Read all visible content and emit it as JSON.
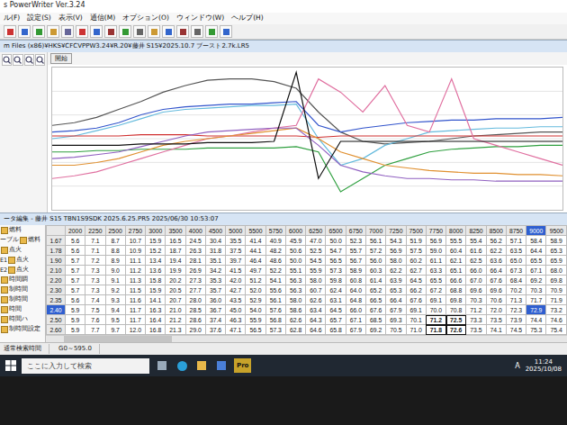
{
  "window": {
    "title": "s PowerWriter Ver.3.24"
  },
  "menu": [
    "ル(F)",
    "設定(S)",
    "表示(V)",
    "通信(M)",
    "オプション(O)",
    "ウィンドウ(W)",
    "ヘルプ(H)"
  ],
  "chart_window": {
    "title": "m Files (x86)¥HKS¥CFCVPPW3.24¥R.20¥藤井 S15¥2025.10.7 ブースト2.7k.LR5",
    "start_button": "開始",
    "series": [
      {
        "color": "#555555",
        "values": [
          60,
          62,
          66,
          72,
          78,
          85,
          90,
          94,
          95,
          95,
          93,
          88,
          70,
          55,
          48,
          46,
          47,
          48,
          50,
          52,
          53,
          54,
          55,
          55
        ]
      },
      {
        "color": "#3355cc",
        "values": [
          55,
          56,
          58,
          62,
          68,
          72,
          74,
          75,
          76,
          76,
          77,
          78,
          60,
          55,
          58,
          60,
          62,
          63,
          64,
          64,
          65,
          65,
          65,
          66
        ]
      },
      {
        "color": "#66bbdd",
        "values": [
          50,
          52,
          56,
          60,
          65,
          70,
          72,
          73,
          74,
          75,
          75,
          76,
          50,
          30,
          35,
          45,
          50,
          55,
          56,
          57,
          58,
          58,
          59,
          59
        ]
      },
      {
        "color": "#d03030",
        "values": [
          52,
          52,
          52,
          52,
          53,
          53,
          53,
          52,
          52,
          52,
          52,
          52,
          51,
          52,
          52,
          52,
          52,
          52,
          52,
          52,
          52,
          52,
          52,
          52
        ]
      },
      {
        "color": "#30a040",
        "values": [
          40,
          40,
          41,
          41,
          42,
          42,
          42,
          43,
          43,
          43,
          43,
          44,
          40,
          10,
          20,
          30,
          35,
          40,
          42,
          43,
          44,
          44,
          45,
          45
        ]
      },
      {
        "color": "#e070a0",
        "values": [
          20,
          22,
          25,
          30,
          35,
          40,
          45,
          50,
          52,
          55,
          58,
          60,
          95,
          85,
          70,
          90,
          60,
          55,
          95,
          50,
          45,
          40,
          35,
          30
        ]
      },
      {
        "color": "#e09030",
        "values": [
          30,
          30,
          32,
          35,
          40,
          45,
          48,
          50,
          52,
          54,
          56,
          58,
          50,
          40,
          35,
          30,
          28,
          26,
          25,
          24,
          24,
          23,
          23,
          22
        ]
      },
      {
        "color": "#9060c0",
        "values": [
          35,
          36,
          38,
          40,
          44,
          48,
          52,
          55,
          56,
          57,
          58,
          58,
          45,
          30,
          25,
          22,
          20,
          20,
          19,
          19,
          18,
          18,
          18,
          18
        ]
      },
      {
        "color": "#111111",
        "values": [
          45,
          45,
          45,
          45,
          46,
          46,
          46,
          47,
          47,
          47,
          48,
          100,
          20,
          48,
          48,
          48,
          48,
          48,
          48,
          48,
          48,
          48,
          48,
          48
        ]
      }
    ]
  },
  "table_window": {
    "title": "ータ編集 - 藤井 S15 TBN1S9SDK 2025.6.25.PR5  2025/06/30 10:53:07"
  },
  "tree": [
    {
      "label": "燃料",
      "prefix": "",
      "selected": false
    },
    {
      "label": "燃料",
      "prefix": "ーブル",
      "selected": false
    },
    {
      "label": "点火",
      "prefix": "",
      "selected": false
    },
    {
      "label": "点火",
      "prefix": "E1",
      "selected": false
    },
    {
      "label": "点火",
      "prefix": "E2",
      "selected": false
    },
    {
      "label": "時間調",
      "prefix": "",
      "selected": false
    },
    {
      "label": "制時間",
      "prefix": "",
      "selected": false
    },
    {
      "label": "制時間",
      "prefix": "",
      "selected": false
    },
    {
      "label": "時間",
      "prefix": "",
      "selected": false
    },
    {
      "label": "時間ハ",
      "prefix": "",
      "selected": false
    },
    {
      "label": "制時間設定",
      "prefix": "",
      "selected": false
    }
  ],
  "table": {
    "columns": [
      {
        "label": "2000",
        "selected": false
      },
      {
        "label": "2250",
        "selected": false
      },
      {
        "label": "2500",
        "selected": false
      },
      {
        "label": "2750",
        "selected": false
      },
      {
        "label": "3000",
        "selected": false
      },
      {
        "label": "3500",
        "selected": false
      },
      {
        "label": "4000",
        "selected": false
      },
      {
        "label": "4500",
        "selected": false
      },
      {
        "label": "5000",
        "selected": false
      },
      {
        "label": "5500",
        "selected": false
      },
      {
        "label": "5750",
        "selected": false
      },
      {
        "label": "6000",
        "selected": false
      },
      {
        "label": "6250",
        "selected": false
      },
      {
        "label": "6500",
        "selected": false
      },
      {
        "label": "6750",
        "selected": false
      },
      {
        "label": "7000",
        "selected": false
      },
      {
        "label": "7250",
        "selected": false
      },
      {
        "label": "7500",
        "selected": false
      },
      {
        "label": "7750",
        "selected": false
      },
      {
        "label": "8000",
        "selected": false
      },
      {
        "label": "8250",
        "selected": false
      },
      {
        "label": "8500",
        "selected": false
      },
      {
        "label": "8750",
        "selected": false
      },
      {
        "label": "9000",
        "selected": true
      },
      {
        "label": "9500",
        "selected": false
      }
    ],
    "rows": [
      {
        "label": "1.67",
        "selected": false,
        "marked": [],
        "cells": [
          "5.6",
          "7.1",
          "8.7",
          "10.7",
          "15.9",
          "16.5",
          "24.5",
          "30.4",
          "35.5",
          "41.4",
          "40.9",
          "45.9",
          "47.0",
          "50.0",
          "52.3",
          "56.1",
          "54.3",
          "51.9",
          "56.9",
          "55.5",
          "55.4",
          "56.2",
          "57.1",
          "58.4",
          "58.9"
        ]
      },
      {
        "label": "1.78",
        "selected": false,
        "marked": [],
        "cells": [
          "5.6",
          "7.1",
          "8.8",
          "10.9",
          "15.2",
          "18.7",
          "26.3",
          "31.8",
          "37.5",
          "44.1",
          "48.2",
          "50.6",
          "52.5",
          "54.7",
          "55.7",
          "57.2",
          "56.9",
          "57.5",
          "59.0",
          "60.4",
          "61.6",
          "62.2",
          "63.5",
          "64.4",
          "65.3"
        ]
      },
      {
        "label": "1.90",
        "selected": false,
        "marked": [],
        "cells": [
          "5.7",
          "7.2",
          "8.9",
          "11.1",
          "13.4",
          "19.4",
          "28.1",
          "35.1",
          "39.7",
          "46.4",
          "48.6",
          "50.0",
          "54.5",
          "56.5",
          "56.7",
          "56.0",
          "58.0",
          "60.2",
          "61.1",
          "62.1",
          "62.5",
          "63.6",
          "65.0",
          "65.5",
          "65.9"
        ]
      },
      {
        "label": "2.10",
        "selected": false,
        "marked": [],
        "cells": [
          "5.7",
          "7.3",
          "9.0",
          "11.2",
          "13.6",
          "19.9",
          "26.9",
          "34.2",
          "41.5",
          "49.7",
          "52.2",
          "55.1",
          "55.9",
          "57.3",
          "58.9",
          "60.3",
          "62.2",
          "62.7",
          "63.3",
          "65.1",
          "66.0",
          "66.4",
          "67.3",
          "67.1",
          "68.0"
        ]
      },
      {
        "label": "2.20",
        "selected": false,
        "marked": [],
        "cells": [
          "5.7",
          "7.3",
          "9.1",
          "11.3",
          "15.8",
          "20.2",
          "27.3",
          "35.3",
          "42.0",
          "51.2",
          "54.1",
          "56.3",
          "58.0",
          "59.8",
          "60.8",
          "61.4",
          "63.9",
          "64.5",
          "65.5",
          "66.6",
          "67.0",
          "67.6",
          "68.4",
          "69.2",
          "69.8"
        ]
      },
      {
        "label": "2.30",
        "selected": false,
        "marked": [],
        "cells": [
          "5.7",
          "7.3",
          "9.2",
          "11.5",
          "15.9",
          "20.5",
          "27.7",
          "35.7",
          "42.7",
          "52.0",
          "55.6",
          "56.3",
          "60.7",
          "62.4",
          "64.0",
          "65.2",
          "65.3",
          "66.2",
          "67.2",
          "68.8",
          "69.6",
          "69.6",
          "70.2",
          "70.3",
          "70.9"
        ]
      },
      {
        "label": "2.35",
        "selected": false,
        "marked": [],
        "cells": [
          "5.6",
          "7.4",
          "9.3",
          "11.6",
          "14.1",
          "20.7",
          "28.0",
          "36.0",
          "43.5",
          "52.9",
          "56.1",
          "58.0",
          "62.6",
          "63.1",
          "64.8",
          "66.5",
          "66.4",
          "67.6",
          "69.1",
          "69.8",
          "70.3",
          "70.6",
          "71.3",
          "71.7",
          "71.9"
        ]
      },
      {
        "label": "2.40",
        "selected": true,
        "marked": [],
        "cells": [
          "5.9",
          "7.5",
          "9.4",
          "11.7",
          "16.3",
          "21.0",
          "28.5",
          "36.7",
          "45.0",
          "54.0",
          "57.6",
          "58.6",
          "63.4",
          "64.5",
          "66.0",
          "67.6",
          "67.9",
          "69.1",
          "70.0",
          "70.8",
          "71.2",
          "72.0",
          "72.3",
          "72.9",
          "73.2"
        ]
      },
      {
        "label": "2.50",
        "selected": false,
        "marked": [
          18,
          19
        ],
        "cells": [
          "5.9",
          "7.6",
          "9.5",
          "11.7",
          "16.4",
          "21.2",
          "28.6",
          "37.4",
          "46.3",
          "55.9",
          "56.8",
          "62.6",
          "64.3",
          "65.7",
          "67.1",
          "68.5",
          "69.3",
          "70.1",
          "71.2",
          "72.5",
          "73.3",
          "73.5",
          "73.9",
          "74.4",
          "74.6"
        ]
      },
      {
        "label": "2.60",
        "selected": false,
        "marked": [
          18,
          19
        ],
        "cells": [
          "5.9",
          "7.7",
          "9.7",
          "12.0",
          "16.8",
          "21.3",
          "29.0",
          "37.6",
          "47.1",
          "56.5",
          "57.3",
          "62.8",
          "64.6",
          "65.8",
          "67.9",
          "69.2",
          "70.5",
          "71.0",
          "71.8",
          "72.6",
          "73.5",
          "74.1",
          "74.5",
          "75.3",
          "75.4"
        ]
      }
    ]
  },
  "status_bar": [
    "通常検索時間",
    "G0～595.0"
  ],
  "taskbar": {
    "search_placeholder": "ここに入力して検索",
    "app_label": "Pro",
    "ime": "A",
    "time": "11:24",
    "date": "2025/10/08"
  }
}
